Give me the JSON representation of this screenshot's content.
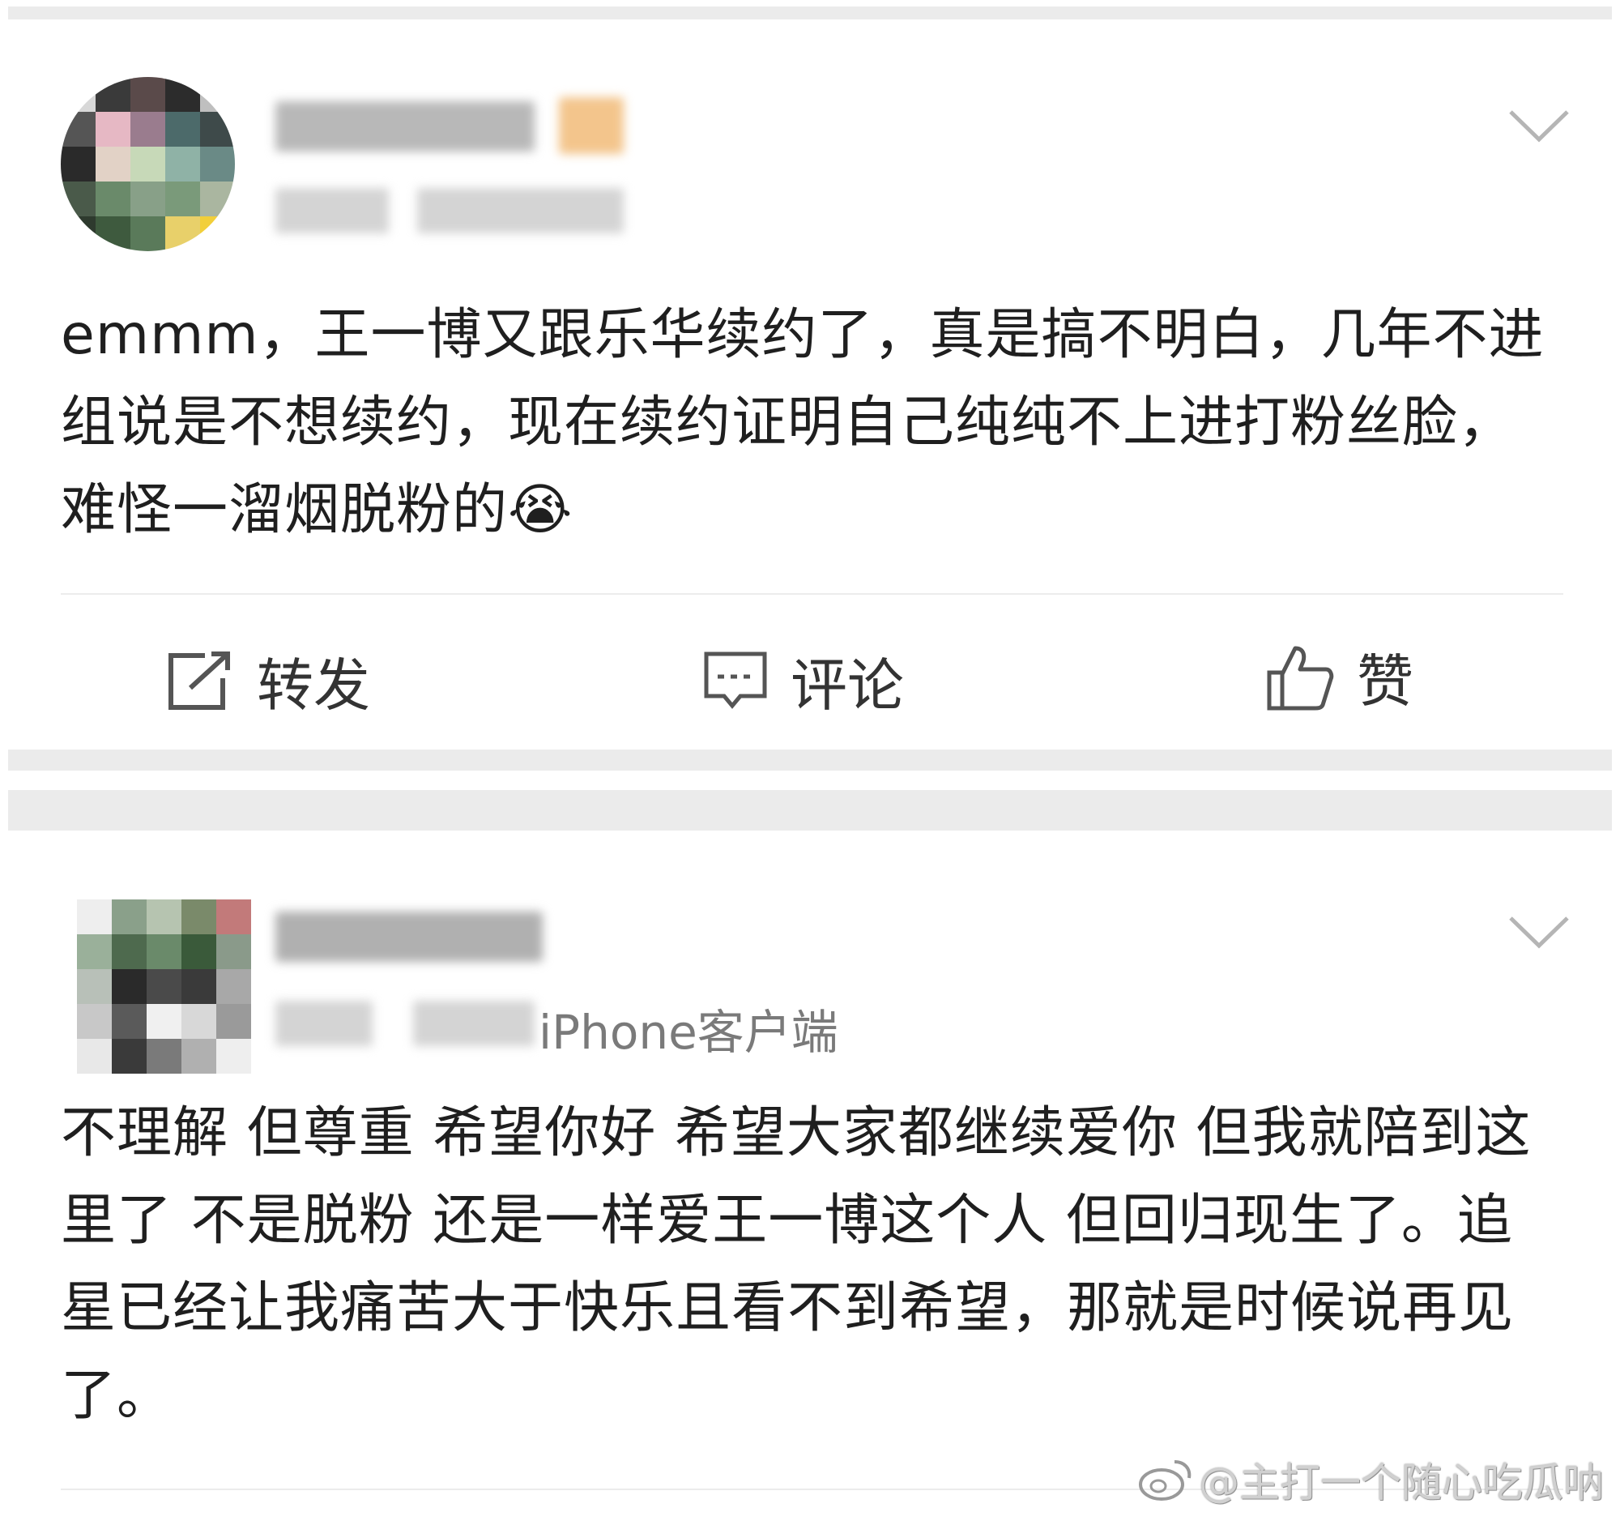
{
  "posts": [
    {
      "text": "emmm，王一博又跟乐华续约了，真是搞不明白，几年不进组说是不想续约，现在续约证明自己纯纯不上进打粉丝脸，难怪一溜烟脱粉的😭",
      "actions": {
        "repost": "转发",
        "comment": "评论",
        "like": "赞"
      }
    },
    {
      "client": "iPhone客户端",
      "text": "不理解 但尊重 希望你好 希望大家都继续爱你 但我就陪到这里了 不是脱粉 还是一样爱王一博这个人 但回归现生了。追星已经让我痛苦大于快乐且看不到希望，那就是时候说再见了。"
    }
  ],
  "watermark": "@主打一个随心吃瓜呐",
  "colors": {
    "band": "#ebebeb",
    "text": "#1f1f1f",
    "icon": "#555555"
  },
  "icons": [
    "chevron-down-icon",
    "repost-icon",
    "comment-icon",
    "like-icon",
    "weibo-logo"
  ]
}
